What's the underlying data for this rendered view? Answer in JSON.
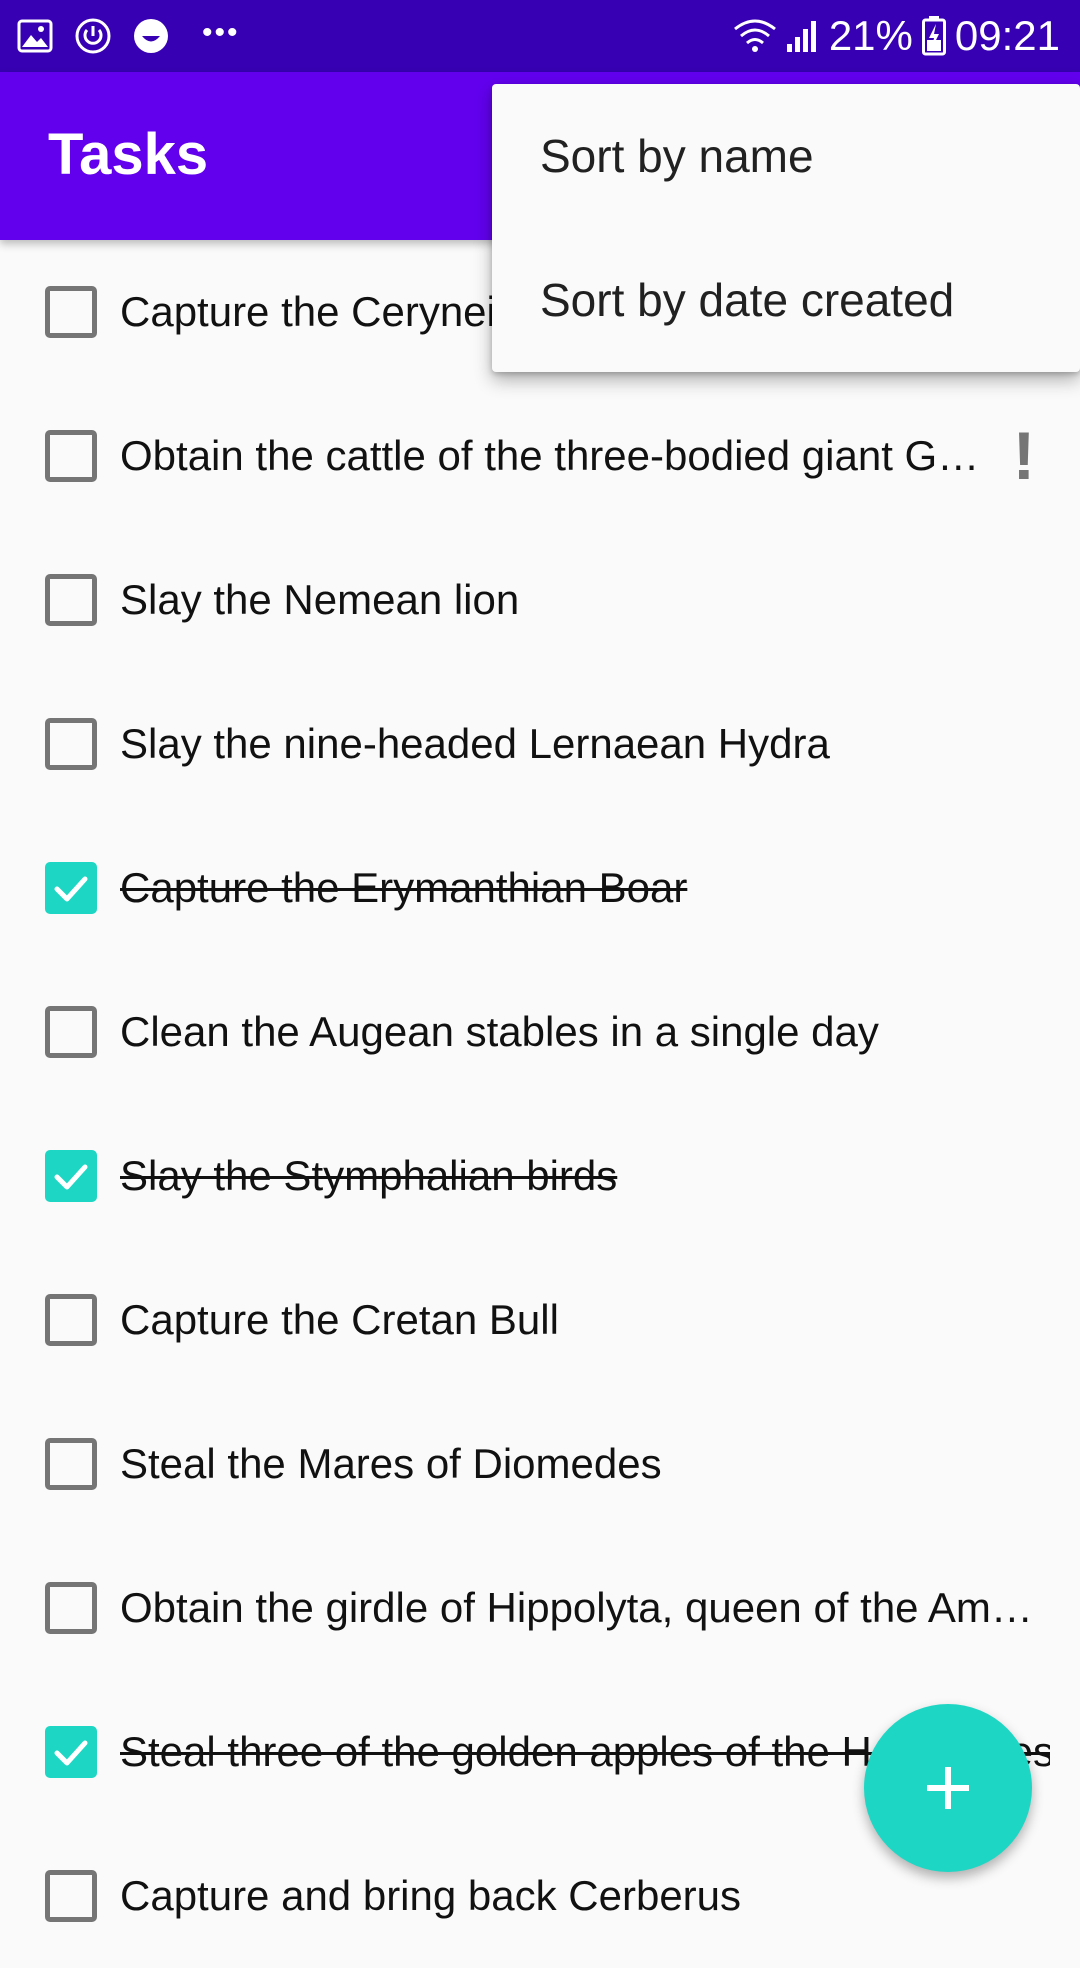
{
  "status_bar": {
    "icons_left": [
      "gallery-icon",
      "power-saver-icon",
      "emoji-icon",
      "more-notifications-icon"
    ],
    "icons_right": [
      "wifi-icon",
      "signal-icon",
      "battery-charging-icon"
    ],
    "battery_percent": "21%",
    "time": "09:21"
  },
  "app_bar": {
    "title": "Tasks"
  },
  "menu": {
    "items": [
      {
        "label": "Sort by name"
      },
      {
        "label": "Sort by date created"
      }
    ]
  },
  "tasks": [
    {
      "title": "Capture the Ceryneian Hind",
      "completed": false,
      "important": false
    },
    {
      "title": "Obtain the cattle of the three-bodied giant Geryon",
      "completed": false,
      "important": true
    },
    {
      "title": "Slay the Nemean lion",
      "completed": false,
      "important": false
    },
    {
      "title": "Slay the nine-headed Lernaean Hydra",
      "completed": false,
      "important": false
    },
    {
      "title": "Capture the Erymanthian Boar",
      "completed": true,
      "important": false
    },
    {
      "title": "Clean the Augean stables in a single day",
      "completed": false,
      "important": false
    },
    {
      "title": "Slay the Stymphalian birds",
      "completed": true,
      "important": false
    },
    {
      "title": "Capture the Cretan Bull",
      "completed": false,
      "important": false
    },
    {
      "title": "Steal the Mares of Diomedes",
      "completed": false,
      "important": false
    },
    {
      "title": "Obtain the girdle of Hippolyta, queen of the Amazons",
      "completed": false,
      "important": false
    },
    {
      "title": "Steal three of the golden apples of the Hesperides",
      "completed": true,
      "important": false
    },
    {
      "title": "Capture and bring back Cerberus",
      "completed": false,
      "important": false
    }
  ],
  "fab": {
    "icon": "plus-icon"
  },
  "colors": {
    "status_bar": "#3700b3",
    "app_bar": "#6200ee",
    "accent": "#1ed6c4",
    "checkbox_border": "#757575",
    "background": "#fafafa"
  }
}
